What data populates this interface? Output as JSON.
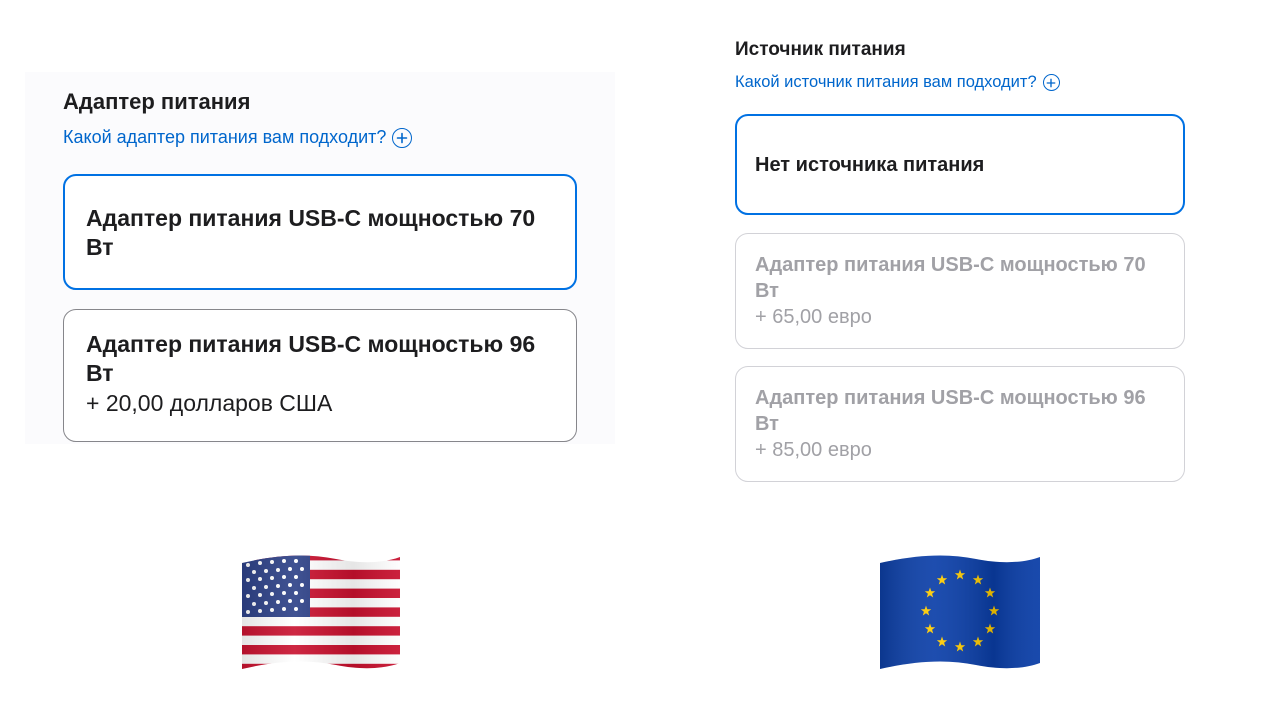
{
  "us": {
    "section_title": "Адаптер питания",
    "help_link": "Какой адаптер питания вам подходит?",
    "options": [
      {
        "label": "Адаптер питания USB-C мощностью 70 Вт",
        "price": "",
        "selected": true
      },
      {
        "label": "Адаптер питания USB-C мощностью 96 Вт",
        "price": "+ 20,00 долларов США",
        "selected": false
      }
    ],
    "flag_icon": "us-flag-icon"
  },
  "eu": {
    "section_title": "Источник питания",
    "help_link": "Какой источник питания вам подходит?",
    "options": [
      {
        "label": "Нет источника питания",
        "price": "",
        "selected": true,
        "disabled": false
      },
      {
        "label": "Адаптер питания USB-C мощностью 70 Вт",
        "price": "+ 65,00 евро",
        "selected": false,
        "disabled": true
      },
      {
        "label": "Адаптер питания USB-C мощностью 96 Вт",
        "price": "+ 85,00 евро",
        "selected": false,
        "disabled": true
      }
    ],
    "flag_icon": "eu-flag-icon"
  },
  "colors": {
    "accent_blue": "#0071e3",
    "link_blue": "#0066cc",
    "text": "#1d1d1f",
    "disabled_text": "#a1a1a6",
    "us_red": "#c8102e",
    "us_blue": "#2b3f86",
    "eu_blue": "#0a3ea8",
    "eu_gold": "#ffcc00"
  }
}
